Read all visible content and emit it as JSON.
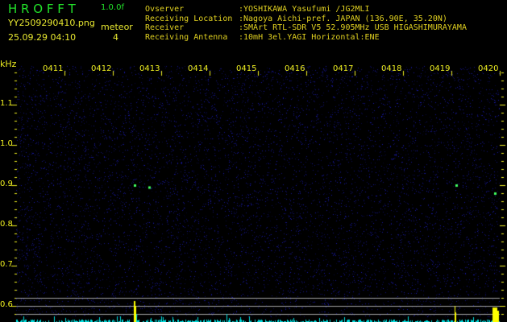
{
  "header": {
    "app_title": "H R O F F T",
    "version": "1.0.0f",
    "filename": "YY2509290410.png",
    "datetime": "25.09.29 04:10",
    "meteor_label": "meteor",
    "meteor_count": "4"
  },
  "info": [
    {
      "label": "Ovserver",
      "value": ":YOSHIKAWA Yasufumi /JG2MLI"
    },
    {
      "label": "Receiving Location",
      "value": ":Nagoya Aichi-pref. JAPAN (136.90E, 35.20N)"
    },
    {
      "label": "Receiver",
      "value": ":SMArt RTL-SDR V5 52.905MHz USB HIGASHIMURAYAMA"
    },
    {
      "label": "Receiving Antenna",
      "value": ":10mH 3el.YAGI Horizontal:ENE"
    }
  ],
  "chart_data": {
    "type": "heatmap",
    "ylabel": "kHz",
    "ylim": [
      0.56,
      1.2
    ],
    "y_ticks": [
      "1.1",
      "1.0",
      "0.9",
      "0.8",
      "0.7",
      "0.6"
    ],
    "x_ticks": [
      "0411",
      "0412",
      "0413",
      "0414",
      "0415",
      "0416",
      "0417",
      "0418",
      "0419",
      "0420"
    ],
    "x_range": [
      "0410",
      "0420"
    ],
    "echoes": [
      {
        "time": "0412.45",
        "freq_khz": 0.9
      },
      {
        "time": "0412.75",
        "freq_khz": 0.895
      },
      {
        "time": "0419.1",
        "freq_khz": 0.9
      },
      {
        "time": "0419.9",
        "freq_khz": 0.88
      }
    ],
    "colors": {
      "background": "#000000",
      "noise": "#1a1aa0",
      "echo": "#40ff60",
      "bars": "#00e0e0",
      "peaks": "#ffff00",
      "reference_lines": "#a0a0a0"
    }
  }
}
